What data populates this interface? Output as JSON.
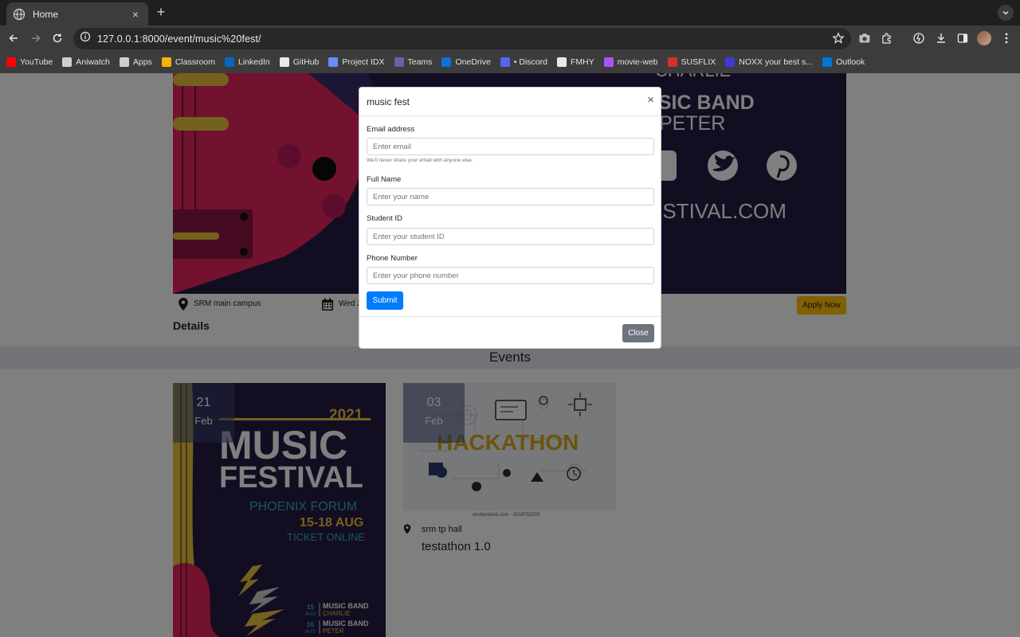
{
  "browser": {
    "tab_title": "Home",
    "new_tab": "+",
    "tab_close": "×",
    "url": "127.0.0.1:8000/event/music%20fest/",
    "bookmarks": [
      {
        "label": "YouTube",
        "icon": "youtube-icon",
        "color": "#ff0000"
      },
      {
        "label": "Aniwatch",
        "icon": "aniwatch-icon",
        "color": "#cfcfcf"
      },
      {
        "label": "Apps",
        "icon": "apps-icon",
        "color": "#cfcfcf"
      },
      {
        "label": "Classroom",
        "icon": "classroom-icon",
        "color": "#f4b400"
      },
      {
        "label": "LinkedIn",
        "icon": "linkedin-icon",
        "color": "#0a66c2"
      },
      {
        "label": "GitHub",
        "icon": "github-icon",
        "color": "#e8e8e8"
      },
      {
        "label": "Project IDX",
        "icon": "idx-icon",
        "color": "#6b8cff"
      },
      {
        "label": "Teams",
        "icon": "teams-icon",
        "color": "#6264a7"
      },
      {
        "label": "OneDrive",
        "icon": "onedrive-icon",
        "color": "#0a74d6"
      },
      {
        "label": "• Discord",
        "icon": "discord-icon",
        "color": "#5865f2"
      },
      {
        "label": "FMHY",
        "icon": "fmhy-icon",
        "color": "#e8e8e8"
      },
      {
        "label": "movie-web",
        "icon": "movie-web-icon",
        "color": "#a855f7"
      },
      {
        "label": "SUSFLIX",
        "icon": "susflix-icon",
        "color": "#d32f2f"
      },
      {
        "label": "NOXX your best s...",
        "icon": "noxx-icon",
        "color": "#3b3bd1"
      },
      {
        "label": "Outlook",
        "icon": "outlook-icon",
        "color": "#0078d4"
      }
    ]
  },
  "event": {
    "location": "SRM main campus",
    "date_partial": "Wed 2",
    "apply_label": "Apply Now",
    "details_heading": "Details",
    "poster_text_1": "MUSIC BAND",
    "poster_text_2": "PETER",
    "poster_text_3": "CHARLIE",
    "poster_text_4": "ESTIVAL.COM"
  },
  "events_section": {
    "heading": "Events",
    "cards": [
      {
        "day": "21",
        "month": "Feb",
        "poster": {
          "year": "2021",
          "title1": "MUSIC",
          "title2": "FESTIVAL",
          "venue": "PHOENIX FORUM",
          "dates": "15-18 AUG",
          "ticket": "TICKET ONLINE",
          "band1_day": "15",
          "band1_month": "AUG",
          "band1_name": "MUSIC BAND",
          "band1_sub": "CHARLIE",
          "band2_day": "16",
          "band2_month": "AUG",
          "band2_name": "MUSIC BAND",
          "band2_sub": "PETER"
        }
      },
      {
        "day": "03",
        "month": "Feb",
        "poster_title": "HACKATHON",
        "watermark": "shutterstock.com · 2019732209",
        "location": "srm tp hall",
        "title": "testathon 1.0"
      }
    ]
  },
  "modal": {
    "title": "music fest",
    "close_x": "×",
    "email_label": "Email address",
    "email_placeholder": "Enter email",
    "email_help": "We'll never share your email with anyone else.",
    "name_label": "Full Name",
    "name_placeholder": "Enter your name",
    "student_label": "Student ID",
    "student_placeholder": "Enter your student ID",
    "phone_label": "Phone Number",
    "phone_placeholder": "Enter your phone number",
    "submit_label": "Submit",
    "close_label": "Close"
  },
  "colors": {
    "primary": "#007bff",
    "secondary": "#6c757d",
    "warning": "#ffc107",
    "poster_purple": "#261a44",
    "poster_pink": "#e91e63",
    "poster_yellow": "#f2c12e"
  }
}
